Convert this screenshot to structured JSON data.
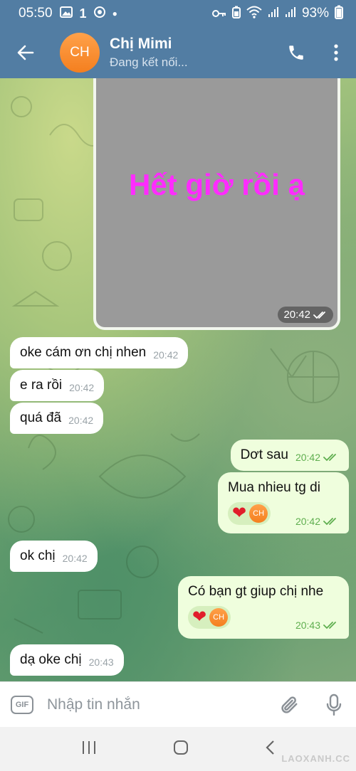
{
  "status_bar": {
    "time": "05:50",
    "battery": "93%",
    "signal_marker": "1"
  },
  "header": {
    "avatar_initials": "CH",
    "contact_name": "Chị Mimi",
    "status": "Đang kết nối..."
  },
  "image_message": {
    "caption_in_image": "Hết giờ rồi ạ",
    "time": "20:42"
  },
  "messages": [
    {
      "direction": "in",
      "text": "oke cám ơn chị nhen",
      "time": "20:42"
    },
    {
      "direction": "in",
      "text": "e ra rồi",
      "time": "20:42"
    },
    {
      "direction": "in",
      "text": "quá đã",
      "time": "20:42"
    },
    {
      "direction": "out",
      "text": "Dơt sau",
      "time": "20:42"
    },
    {
      "direction": "out",
      "text": "Mua nhieu tg di",
      "time": "20:42",
      "reaction": "heart",
      "reaction_user": "CH"
    },
    {
      "direction": "in",
      "text": "ok chị",
      "time": "20:42"
    },
    {
      "direction": "out",
      "text": "Có bạn gt giup chị nhe",
      "time": "20:43",
      "reaction": "heart",
      "reaction_user": "CH"
    },
    {
      "direction": "in",
      "text": "dạ oke chị",
      "time": "20:43"
    }
  ],
  "input": {
    "gif_label": "GIF",
    "placeholder": "Nhập tin nhắn"
  },
  "watermark": "LAOXANH.CC",
  "colors": {
    "header": "#527da3",
    "outgoing_bubble": "#effedd",
    "incoming_bubble": "#ffffff",
    "avatar": "#f58a2c",
    "read_check": "#5fae4f",
    "image_text": "#ff2bff"
  }
}
